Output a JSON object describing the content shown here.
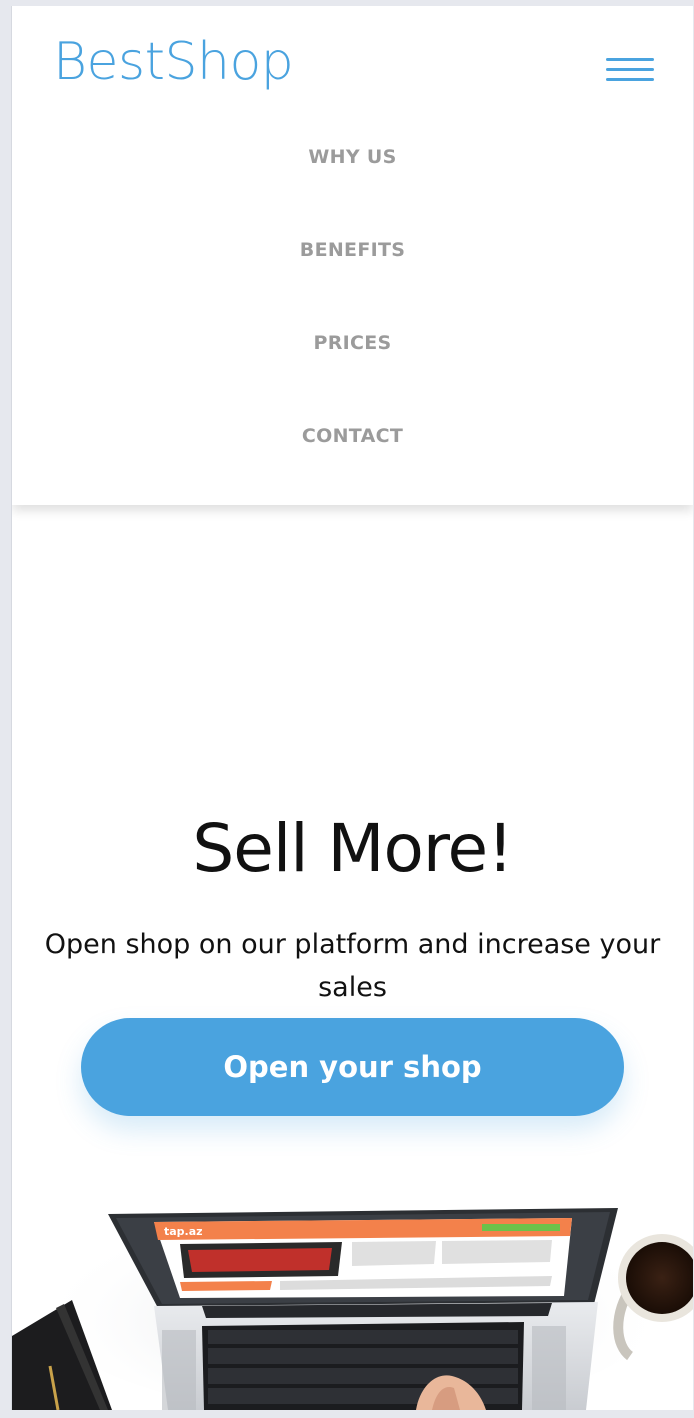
{
  "header": {
    "logo": "BestShop",
    "menu_icon": "hamburger-menu-icon"
  },
  "nav": {
    "items": [
      {
        "label": "WHY US"
      },
      {
        "label": "BENEFITS"
      },
      {
        "label": "PRICES"
      },
      {
        "label": "CONTACT"
      }
    ]
  },
  "hero": {
    "title": "Sell More!",
    "subtitle": "Open shop on our platform and increase your sales",
    "cta_label": "Open your shop"
  },
  "colors": {
    "accent": "#4aa3df",
    "nav_text": "#9b9b9b",
    "screen_orange": "#f3814b"
  },
  "image": {
    "screen_logo": "tap.az"
  }
}
